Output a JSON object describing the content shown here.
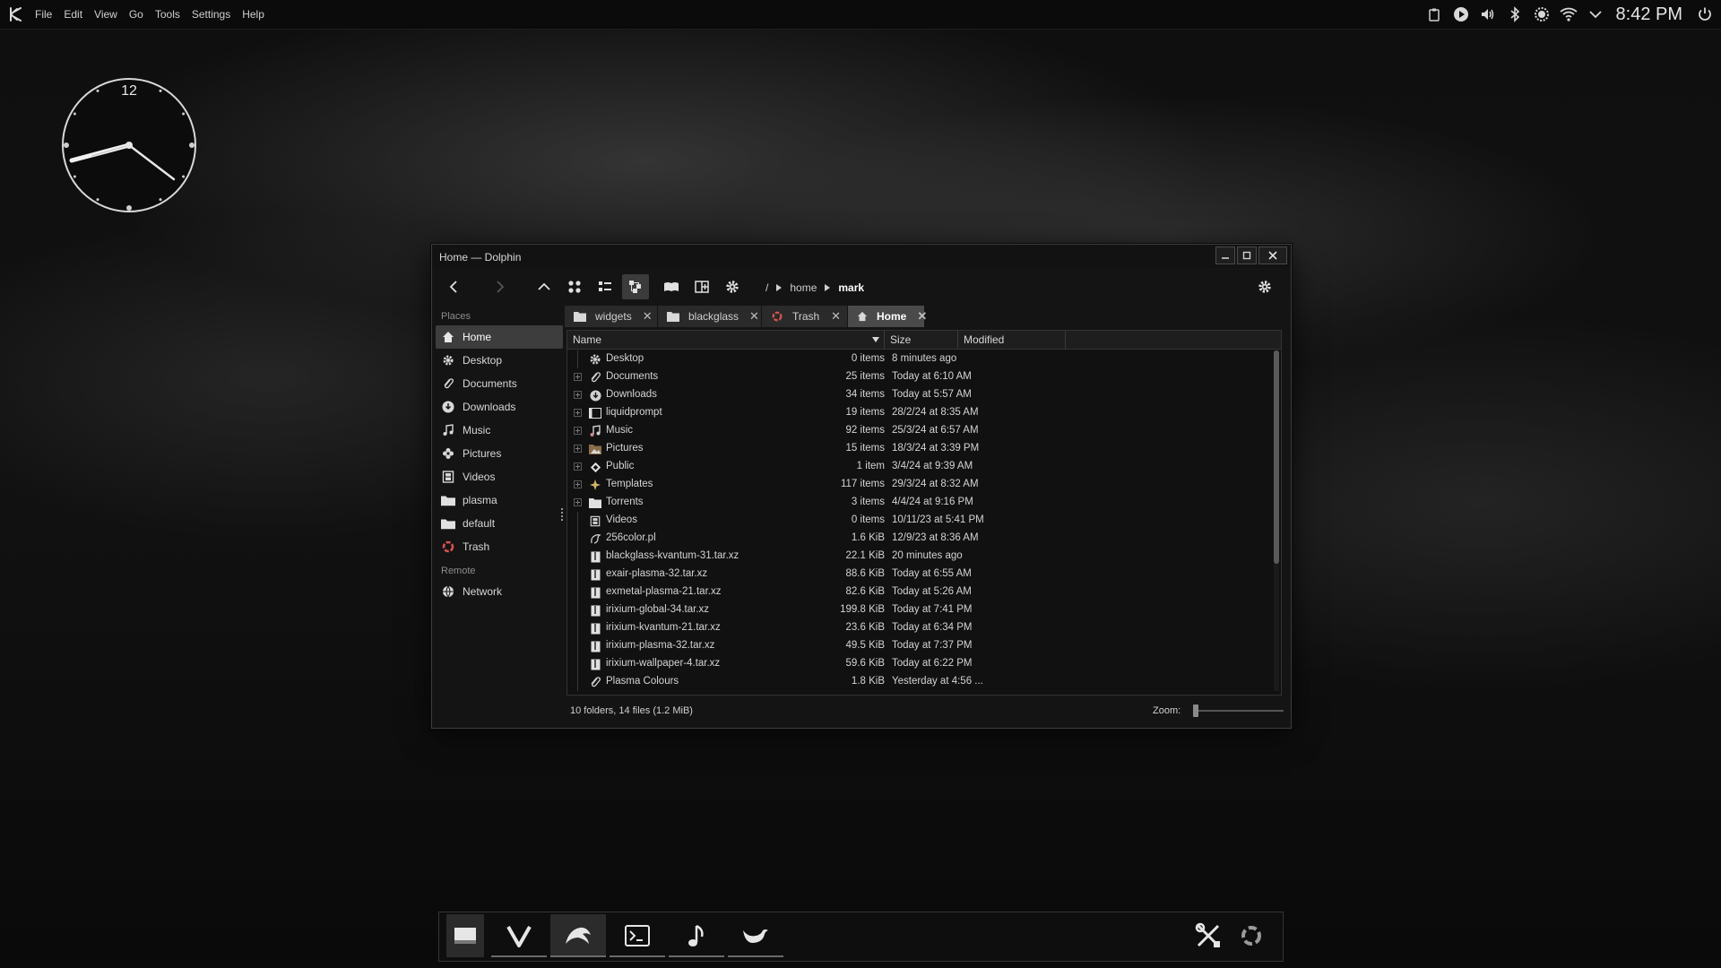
{
  "menu": [
    "File",
    "Edit",
    "View",
    "Go",
    "Tools",
    "Settings",
    "Help"
  ],
  "tray": {
    "icons": [
      "clipboard-icon",
      "media-play-icon",
      "volume-icon",
      "bluetooth-icon",
      "brightness-icon",
      "wifi-icon",
      "chevron-down-icon"
    ],
    "time": "8:42 PM"
  },
  "analog_clock": {
    "numeral": "12"
  },
  "window": {
    "title": "Home — Dolphin",
    "breadcrumb": {
      "root": "/",
      "parent": "home",
      "current": "mark"
    },
    "places_heading": "Places",
    "places": [
      "Home",
      "Desktop",
      "Documents",
      "Downloads",
      "Music",
      "Pictures",
      "Videos",
      "plasma",
      "default",
      "Trash"
    ],
    "remote_heading": "Remote",
    "remote": [
      "Network"
    ],
    "tabs": [
      "widgets",
      "blackglass",
      "Trash",
      "Home"
    ],
    "columns": {
      "name": "Name",
      "size": "Size",
      "modified": "Modified"
    },
    "files": [
      {
        "name": "Desktop",
        "size": "0 items",
        "modified": "8 minutes ago"
      },
      {
        "name": "Documents",
        "size": "25 items",
        "modified": "Today at 6:10 AM"
      },
      {
        "name": "Downloads",
        "size": "34 items",
        "modified": "Today at 5:57 AM"
      },
      {
        "name": "liquidprompt",
        "size": "19 items",
        "modified": "28/2/24 at 8:35 AM"
      },
      {
        "name": "Music",
        "size": "92 items",
        "modified": "25/3/24 at 6:57 AM"
      },
      {
        "name": "Pictures",
        "size": "15 items",
        "modified": "18/3/24 at 3:39 PM"
      },
      {
        "name": "Public",
        "size": "1 item",
        "modified": "3/4/24 at 9:39 AM"
      },
      {
        "name": "Templates",
        "size": "117 items",
        "modified": "29/3/24 at 8:32 AM"
      },
      {
        "name": "Torrents",
        "size": "3 items",
        "modified": "4/4/24 at 9:16 PM"
      },
      {
        "name": "Videos",
        "size": "0 items",
        "modified": "10/11/23 at 5:41 PM"
      },
      {
        "name": "256color.pl",
        "size": "1.6 KiB",
        "modified": "12/9/23 at 8:36 AM"
      },
      {
        "name": "blackglass-kvantum-31.tar.xz",
        "size": "22.1 KiB",
        "modified": "20 minutes ago"
      },
      {
        "name": "exair-plasma-32.tar.xz",
        "size": "88.6 KiB",
        "modified": "Today at 6:55 AM"
      },
      {
        "name": "exmetal-plasma-21.tar.xz",
        "size": "82.6 KiB",
        "modified": "Today at 5:26 AM"
      },
      {
        "name": "irixium-global-34.tar.xz",
        "size": "199.8 KiB",
        "modified": "Today at 7:41 PM"
      },
      {
        "name": "irixium-kvantum-21.tar.xz",
        "size": "23.6 KiB",
        "modified": "Today at 6:34 PM"
      },
      {
        "name": "irixium-plasma-32.tar.xz",
        "size": "49.5 KiB",
        "modified": "Today at 7:37 PM"
      },
      {
        "name": "irixium-wallpaper-4.tar.xz",
        "size": "59.6 KiB",
        "modified": "Today at 6:22 PM"
      },
      {
        "name": "Plasma Colours",
        "size": "1.8 KiB",
        "modified": "Yesterday at 4:56 ..."
      }
    ],
    "status": "10 folders, 14 files (1.2 MiB)",
    "zoom_label": "Zoom:"
  },
  "colors": {
    "accent": "#3d3d3d",
    "trash_red": "#d9534f",
    "panel_bg": "#0b0b0b"
  }
}
